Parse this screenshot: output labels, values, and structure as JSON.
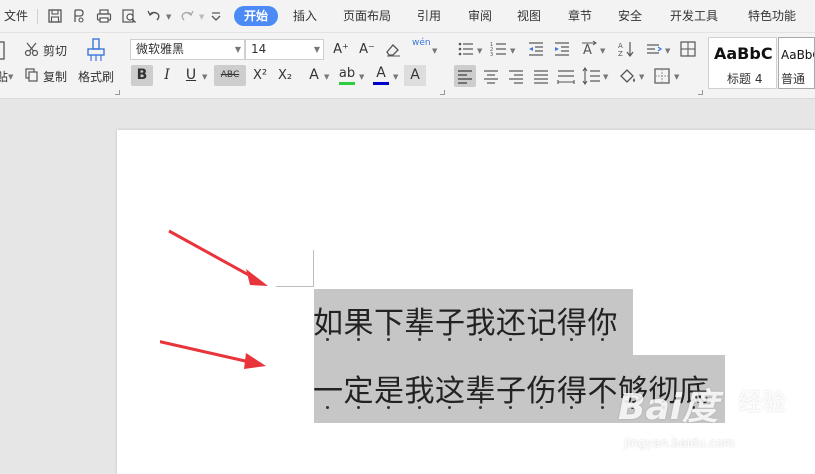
{
  "menubar": {
    "file_label": "文件",
    "tabs": [
      "开始",
      "插入",
      "页面布局",
      "引用",
      "审阅",
      "视图",
      "章节",
      "安全",
      "开发工具",
      "特色功能"
    ],
    "active_tab": "开始"
  },
  "ribbon": {
    "cut_label": "剪切",
    "paste_label": "贴",
    "copy_label": "复制",
    "format_painter_label": "格式刷",
    "font_name": "微软雅黑",
    "font_size": "14",
    "font_grow_label": "A⁺",
    "font_shrink_label": "A⁻",
    "bold_label": "B",
    "italic_label": "I",
    "underline_label": "U",
    "strike_label": "ABC",
    "superscript_label": "X²",
    "subscript_label": "X₂",
    "text_effect_label": "A",
    "highlight_label": "ab",
    "font_color_label": "A",
    "char_shade_label": "A",
    "pinyin_label": "wén",
    "styles": [
      {
        "preview": "AaBbC",
        "name": "标题 4"
      },
      {
        "preview": "AaBbC",
        "name": "普通(网"
      }
    ],
    "colors": {
      "highlight": "#2ecc40",
      "font_color": "#0000cc",
      "accent": "#4c8bf5"
    }
  },
  "document": {
    "lines": [
      "如果下辈子我还记得你",
      "一定是我这辈子伤得不够彻底"
    ],
    "selection_color": "#c6c6c6"
  },
  "annotation": {
    "arrow_color": "#e8343a"
  },
  "watermark": {
    "logo": "Bai度",
    "cn": "经验",
    "url": "jingyan.baidu.com"
  }
}
